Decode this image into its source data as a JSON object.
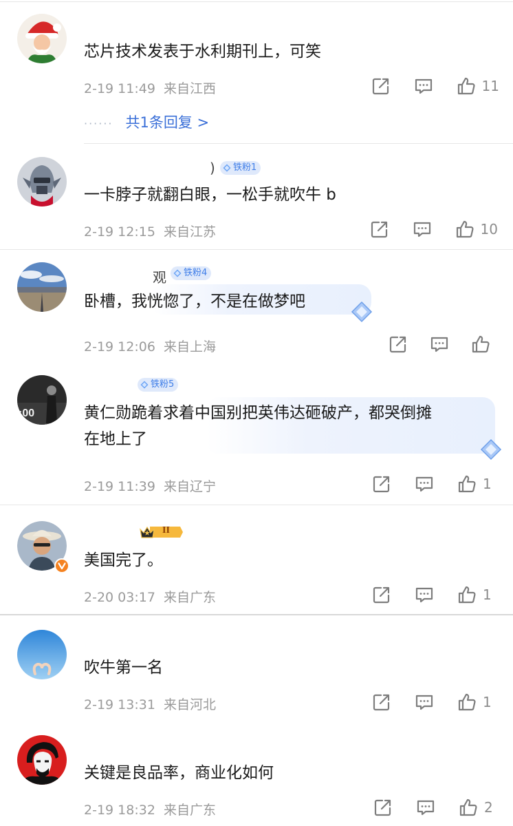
{
  "comments": [
    {
      "username": "",
      "badge": "",
      "content": "芯片技术发表于水利期刊上，可笑",
      "time": "2-19 11:49",
      "location": "来自江西",
      "likes": "11",
      "replies": "共1条回复 >",
      "avatar_icon": "santa-avatar"
    },
    {
      "username": ")",
      "badge": "铁粉1",
      "content": "一卡脖子就翻白眼，一松手就吹牛 b",
      "time": "2-19 12:15",
      "location": "来自江苏",
      "likes": "10",
      "avatar_icon": "robot-avatar"
    },
    {
      "username": "观",
      "badge": "铁粉4",
      "content": "卧槽，我恍惚了，不是在做梦吧",
      "time": "2-19 12:06",
      "location": "来自上海",
      "likes": "",
      "avatar_icon": "landscape-avatar"
    },
    {
      "username": "",
      "badge": "铁粉5",
      "content_line1": "黄仁勋跪着求着中国别把英伟达砸破产，都哭倒摊",
      "content_line2": "在地上了",
      "time": "2-19 11:39",
      "location": "来自辽宁",
      "likes": "1",
      "avatar_icon": "photo-avatar"
    },
    {
      "username": "",
      "badge": "II",
      "content": "美国完了。",
      "time": "2-20 03:17",
      "location": "来自广东",
      "likes": "1",
      "avatar_icon": "hat-man-avatar"
    },
    {
      "username": "",
      "content": "吹牛第一名",
      "time": "2-19 13:31",
      "location": "来自河北",
      "likes": "1",
      "avatar_icon": "sky-heart-avatar"
    },
    {
      "username": "",
      "content": "关键是良品率，商业化如何",
      "time": "2-19 18:32",
      "location": "来自广东",
      "likes": "2",
      "avatar_icon": "che-portrait-avatar"
    }
  ],
  "colors": {
    "badge_bg": "#dfe9fb",
    "badge_text": "#3f7ee8",
    "reply_link": "#3a6fd8",
    "meta": "#9a9a9a"
  },
  "icons": [
    "share-icon",
    "comment-icon",
    "like-icon",
    "gem-icon",
    "crown-icon",
    "verified-v-icon"
  ]
}
